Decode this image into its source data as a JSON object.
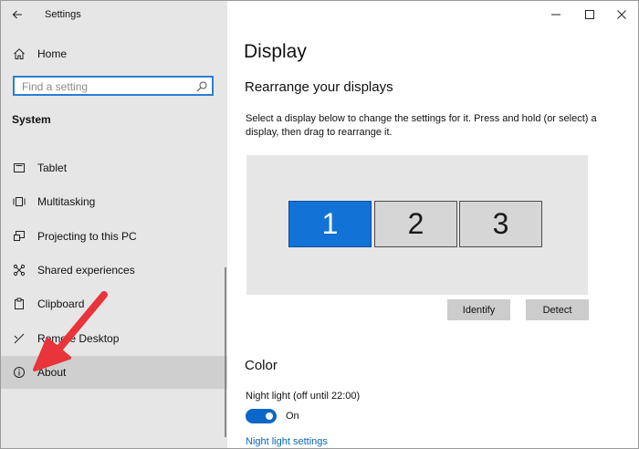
{
  "window": {
    "app_title": "Settings"
  },
  "sidebar": {
    "home_label": "Home",
    "search_placeholder": "Find a setting",
    "section_title": "System",
    "items": [
      {
        "label": "Tablet",
        "icon": "tablet-icon"
      },
      {
        "label": "Multitasking",
        "icon": "multitasking-icon"
      },
      {
        "label": "Projecting to this PC",
        "icon": "projecting-icon"
      },
      {
        "label": "Shared experiences",
        "icon": "shared-experiences-icon"
      },
      {
        "label": "Clipboard",
        "icon": "clipboard-icon"
      },
      {
        "label": "Remote Desktop",
        "icon": "remote-desktop-icon"
      },
      {
        "label": "About",
        "icon": "info-icon",
        "selected": true
      }
    ]
  },
  "main": {
    "page_title": "Display",
    "rearrange_title": "Rearrange your displays",
    "rearrange_description": "Select a display below to change the settings for it. Press and hold (or select) a display, then drag to rearrange it.",
    "monitors": [
      {
        "label": "1",
        "active": true
      },
      {
        "label": "2",
        "active": false
      },
      {
        "label": "3",
        "active": false
      }
    ],
    "identify_label": "Identify",
    "detect_label": "Detect",
    "color_title": "Color",
    "night_light_label": "Night light (off until 22:00)",
    "night_light_state": "On",
    "night_light_link": "Night light settings"
  },
  "colors": {
    "accent": "#0a66c7",
    "selected_monitor": "#1272d6",
    "annotation_arrow": "#e8343a",
    "sidebar_bg": "#e6e6e6"
  }
}
